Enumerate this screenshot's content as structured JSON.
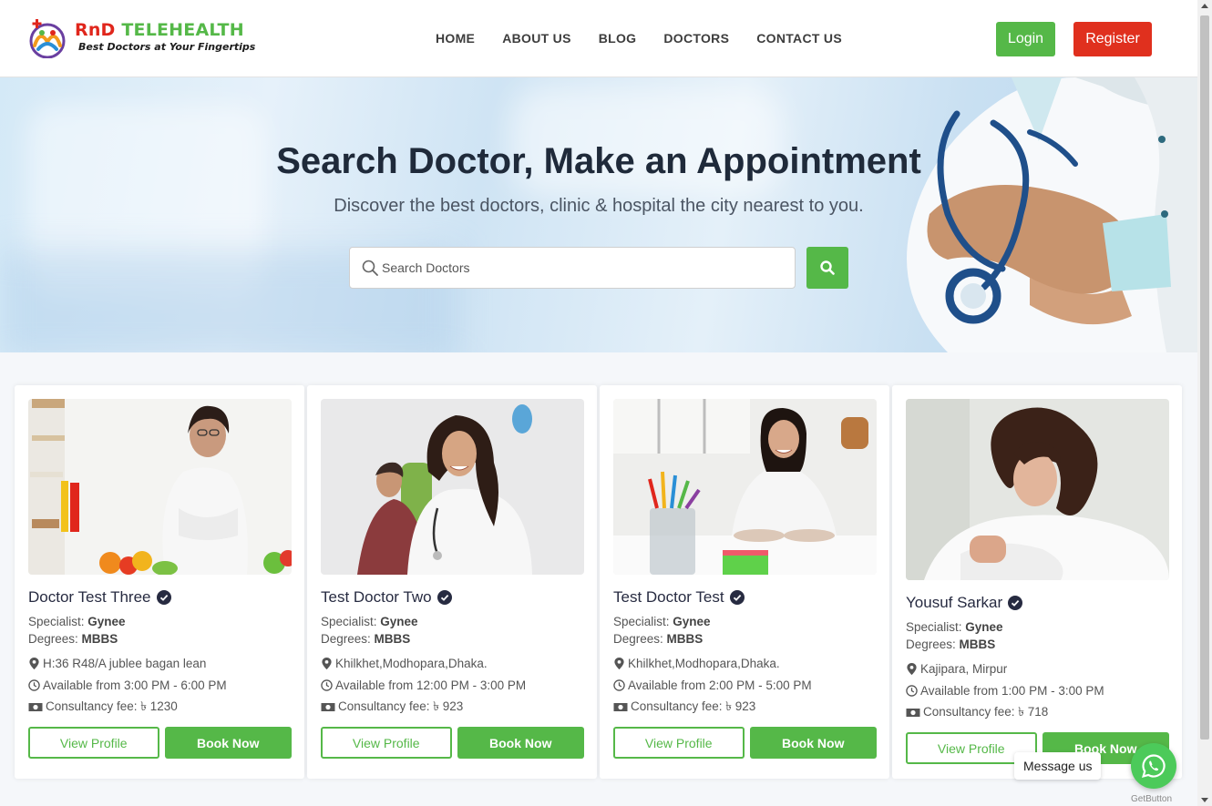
{
  "brand": {
    "name_part1": "RnD",
    "name_part2": "TELEHEALTH",
    "tagline": "Best Doctors at Your Fingertips",
    "colors": {
      "red": "#e0261c",
      "green": "#55b848"
    }
  },
  "nav": {
    "items": [
      {
        "label": "HOME"
      },
      {
        "label": "ABOUT US"
      },
      {
        "label": "BLOG"
      },
      {
        "label": "DOCTORS"
      },
      {
        "label": "CONTACT US"
      }
    ],
    "login_label": "Login",
    "register_label": "Register"
  },
  "hero": {
    "title": "Search Doctor, Make an Appointment",
    "subtitle": "Discover the best doctors, clinic & hospital the city nearest to you.",
    "search": {
      "placeholder": "Search Doctors",
      "value": "",
      "icon": "search-icon"
    },
    "search_button_icon": "search-icon"
  },
  "doctors": [
    {
      "name": "Doctor Test Three",
      "specialist_label": "Specialist:",
      "specialist": "Gynee",
      "degrees_label": "Degrees:",
      "degrees": "MBBS",
      "address": "H:36 R48/A jublee bagan lean",
      "availability": "Available from 3:00 PM - 6:00 PM",
      "fee": "Consultancy fee: ৳ 1230",
      "view_label": "View Profile",
      "book_label": "Book Now"
    },
    {
      "name": "Test Doctor Two",
      "specialist_label": "Specialist:",
      "specialist": "Gynee",
      "degrees_label": "Degrees:",
      "degrees": "MBBS",
      "address": "Khilkhet,Modhopara,Dhaka.",
      "availability": "Available from 12:00 PM - 3:00 PM",
      "fee": "Consultancy fee: ৳ 923",
      "view_label": "View Profile",
      "book_label": "Book Now"
    },
    {
      "name": "Test Doctor Test",
      "specialist_label": "Specialist:",
      "specialist": "Gynee",
      "degrees_label": "Degrees:",
      "degrees": "MBBS",
      "address": "Khilkhet,Modhopara,Dhaka.",
      "availability": "Available from 2:00 PM - 5:00 PM",
      "fee": "Consultancy fee: ৳ 923",
      "view_label": "View Profile",
      "book_label": "Book Now"
    },
    {
      "name": "Yousuf Sarkar",
      "specialist_label": "Specialist:",
      "specialist": "Gynee",
      "degrees_label": "Degrees:",
      "degrees": "MBBS",
      "address": "Kajipara, Mirpur",
      "availability": "Available from 1:00 PM - 3:00 PM",
      "fee": "Consultancy fee: ৳ 718",
      "view_label": "View Profile",
      "book_label": "Book Now"
    }
  ],
  "widget": {
    "message_label": "Message us",
    "icon": "whatsapp-icon",
    "credit": "GetButton"
  }
}
